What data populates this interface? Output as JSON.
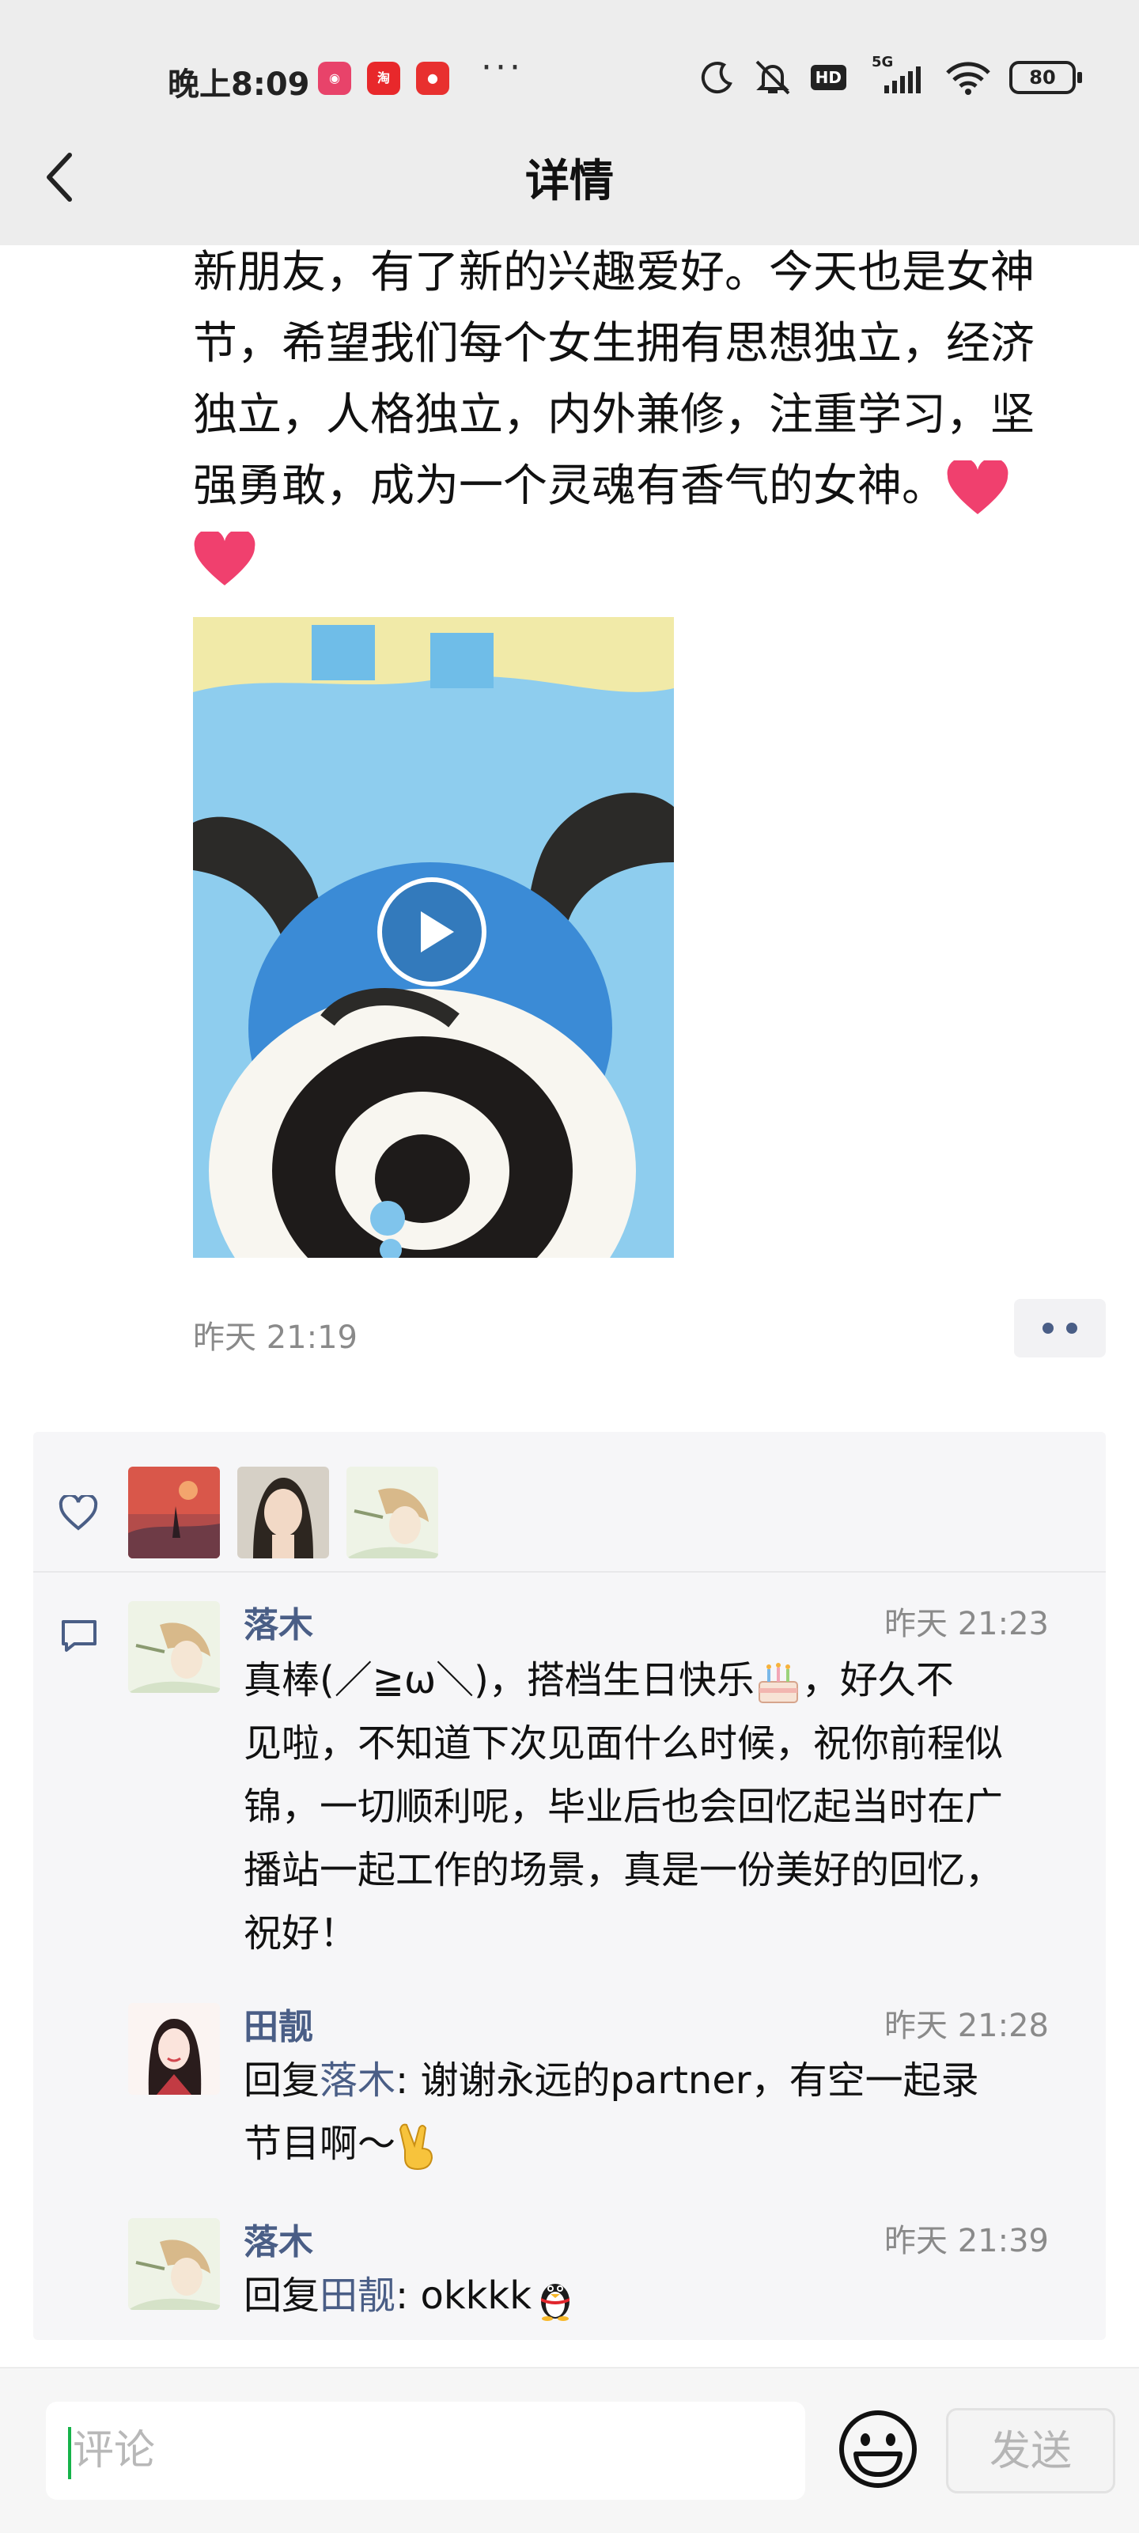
{
  "status_bar": {
    "time": "晚上8:09",
    "app_icons": [
      "app-badge-icon-1",
      "taobao-icon",
      "app-badge-icon-3"
    ],
    "overflow": "···",
    "hd_label": "HD",
    "network": "5G",
    "battery": "80"
  },
  "nav": {
    "title": "详情",
    "back_icon": "chevron-left-icon"
  },
  "post": {
    "text": "新朋友，有了新的兴趣爱好。今天也是女神节，希望我们每个女生拥有思想独立，经济独立，人格独立，内外兼修，注重学习，坚强勇敢，成为一个灵魂有香气的女神。",
    "text_lines": [
      "新朋友，有了新的兴趣爱好。今天也是女神",
      "节，希望我们每个女生拥有思想独立，经济",
      "独立，人格独立，内外兼修，注重学习，坚",
      "强勇敢，成为一个灵魂有香气的女神。"
    ],
    "emoji": "heart-icon",
    "video": {
      "play_icon": "play-icon"
    },
    "time": "昨天 21:19",
    "more_icon": "more-dots-icon"
  },
  "likes": {
    "icon": "heart-outline-icon",
    "avatars": [
      "avatar-sunset",
      "avatar-girl",
      "avatar-anime"
    ]
  },
  "comments": {
    "icon": "comment-icon",
    "items": [
      {
        "name": "落木",
        "time": "昨天 21:23",
        "lines": [
          "真棒(／≧ω＼)，搭档生日快乐",
          "见啦，不知道下次见面什么时候，祝你前程似",
          "锦，一切顺利呢，毕业后也会回忆起当时在广",
          "播站一起工作的场景，真是一份美好的回忆，",
          "祝好！"
        ],
        "line1_tail": "，好久不",
        "emoji": "birthday-cake-icon"
      },
      {
        "name": "田靓",
        "time": "昨天 21:28",
        "reply_prefix": "回复",
        "reply_to": "落木",
        "lines": [
          ": 谢谢永远的partner，有空一起录",
          "节目啊～"
        ],
        "emoji": "victory-hand-icon"
      },
      {
        "name": "落木",
        "time": "昨天 21:39",
        "reply_prefix": "回复",
        "reply_to": "田靓",
        "text": ": okkkk",
        "emoji": "penguin-icon"
      }
    ]
  },
  "input": {
    "placeholder": "评论",
    "emoji_icon": "smiley-icon",
    "send_label": "发送"
  }
}
